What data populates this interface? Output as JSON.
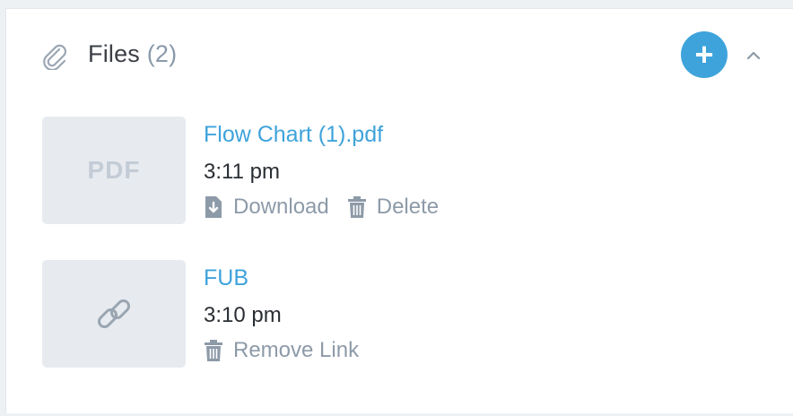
{
  "header": {
    "title": "Files",
    "count": "(2)",
    "icon": "paperclip-icon",
    "add_icon": "plus-icon",
    "add_label": "+",
    "collapse_icon": "chevron-up-icon"
  },
  "files": [
    {
      "thumb_label": "PDF",
      "name": "Flow Chart (1).pdf",
      "time": "3:11 pm",
      "actions": [
        {
          "label": "Download",
          "icon": "download-icon"
        },
        {
          "label": "Delete",
          "icon": "trash-icon"
        }
      ]
    },
    {
      "thumb_icon": "link-icon",
      "name": "FUB",
      "time": "3:10 pm",
      "actions": [
        {
          "label": "Remove Link",
          "icon": "trash-icon"
        }
      ]
    }
  ],
  "colors": {
    "accent": "#3ea3db",
    "muted": "#8d9aa8",
    "thumb_bg": "#e7ebef"
  }
}
